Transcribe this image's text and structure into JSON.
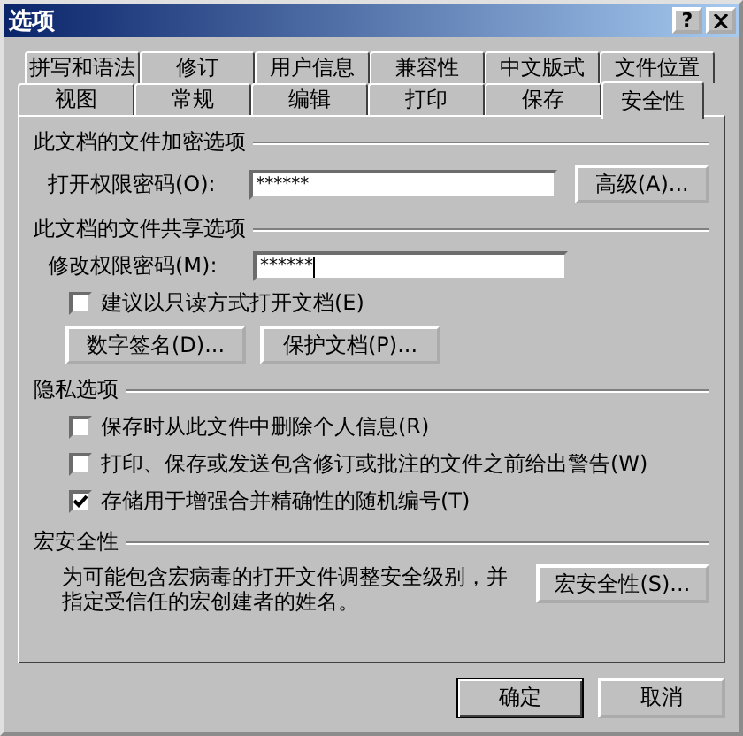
{
  "window": {
    "title": "选项",
    "help_button": "?"
  },
  "tab_rows": [
    [
      {
        "label": "拼写和语法",
        "selected": false
      },
      {
        "label": "修订",
        "selected": false
      },
      {
        "label": "用户信息",
        "selected": false
      },
      {
        "label": "兼容性",
        "selected": false
      },
      {
        "label": "中文版式",
        "selected": false
      },
      {
        "label": "文件位置",
        "selected": false
      }
    ],
    [
      {
        "label": "视图",
        "selected": false
      },
      {
        "label": "常规",
        "selected": false
      },
      {
        "label": "编辑",
        "selected": false
      },
      {
        "label": "打印",
        "selected": false
      },
      {
        "label": "保存",
        "selected": false
      },
      {
        "label": "安全性",
        "selected": true
      }
    ]
  ],
  "sections": [
    {
      "title": "此文档的文件加密选项",
      "items": [
        {
          "kind": "password",
          "label": "打开权限密码(O):",
          "value": "******",
          "focused": false,
          "button": "高级(A)..."
        }
      ]
    },
    {
      "title": "此文档的文件共享选项",
      "items": [
        {
          "kind": "password",
          "label": "修改权限密码(M):",
          "value": "******",
          "focused": true
        },
        {
          "kind": "checkbox",
          "label": "建议以只读方式打开文档(E)",
          "checked": false
        },
        {
          "kind": "buttons",
          "buttons": [
            "数字签名(D)...",
            "保护文档(P)..."
          ]
        }
      ]
    },
    {
      "title": "隐私选项",
      "items": [
        {
          "kind": "checkbox",
          "label": "保存时从此文件中删除个人信息(R)",
          "checked": false
        },
        {
          "kind": "checkbox",
          "label": "打印、保存或发送包含修订或批注的文件之前给出警告(W)",
          "checked": false
        },
        {
          "kind": "checkbox",
          "label": "存储用于增强合并精确性的随机编号(T)",
          "checked": true
        }
      ]
    },
    {
      "title": "宏安全性",
      "items": [
        {
          "kind": "text_button",
          "text": "为可能包含宏病毒的打开文件调整安全级别，并指定受信任的宏创建者的姓名。",
          "button": "宏安全性(S)..."
        }
      ]
    }
  ],
  "footer_buttons": [
    "确定",
    "取消"
  ]
}
